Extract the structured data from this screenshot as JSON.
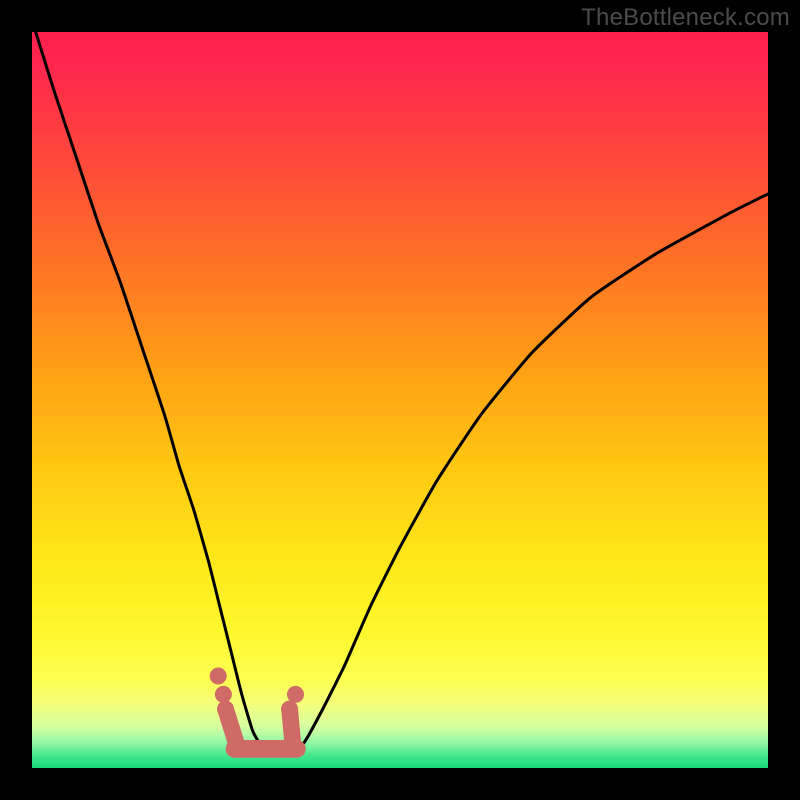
{
  "watermark": "TheBottleneck.com",
  "colors": {
    "frame": "#000000",
    "gradient_stops": [
      {
        "offset": 0.0,
        "color": "#ff1f4f"
      },
      {
        "offset": 0.06,
        "color": "#ff2a4b"
      },
      {
        "offset": 0.18,
        "color": "#ff4a3a"
      },
      {
        "offset": 0.32,
        "color": "#ff7425"
      },
      {
        "offset": 0.46,
        "color": "#ffa015"
      },
      {
        "offset": 0.6,
        "color": "#ffca12"
      },
      {
        "offset": 0.72,
        "color": "#ffe81a"
      },
      {
        "offset": 0.82,
        "color": "#fff82f"
      },
      {
        "offset": 0.885,
        "color": "#fcff56"
      },
      {
        "offset": 0.915,
        "color": "#f3ff7d"
      },
      {
        "offset": 0.945,
        "color": "#d3ffa2"
      },
      {
        "offset": 0.965,
        "color": "#94f8a6"
      },
      {
        "offset": 0.985,
        "color": "#3de68c"
      },
      {
        "offset": 1.0,
        "color": "#17d878"
      }
    ],
    "curve": "#000000",
    "bumps": "#cf6a66"
  },
  "chart_data": {
    "type": "line",
    "title": "",
    "xlabel": "",
    "ylabel": "",
    "xlim": [
      0,
      100
    ],
    "ylim": [
      0,
      100
    ],
    "grid": false,
    "legend": false,
    "series": [
      {
        "name": "bottleneck-curve",
        "x": [
          0.5,
          3,
          6,
          9,
          12,
          15,
          18,
          20,
          22,
          24,
          25.5,
          27,
          28.5,
          30,
          31.5,
          33,
          35,
          37,
          39.5,
          42.5,
          46,
          50,
          55,
          61,
          68,
          76,
          85,
          95,
          100
        ],
        "y": [
          100,
          92,
          83,
          74,
          66,
          57,
          48,
          41,
          35,
          28,
          22,
          16,
          10,
          5,
          2.5,
          2,
          2,
          3.5,
          8,
          14,
          22,
          30,
          39,
          48,
          56.5,
          64,
          70,
          75.5,
          78
        ]
      }
    ],
    "floor_bumps": {
      "description": "small markers near curve minimum",
      "left_cluster": [
        {
          "x": 25.3,
          "y": 12.5
        },
        {
          "x": 26.0,
          "y": 10.0
        },
        {
          "x": 26.3,
          "y": 8.0
        }
      ],
      "right_cluster": [
        {
          "x": 35.0,
          "y": 8.0
        },
        {
          "x": 35.8,
          "y": 10.0
        }
      ],
      "bottom_run": {
        "x_from": 27.5,
        "x_to": 36.0,
        "y": 2.6,
        "thickness": 2.4
      }
    }
  }
}
